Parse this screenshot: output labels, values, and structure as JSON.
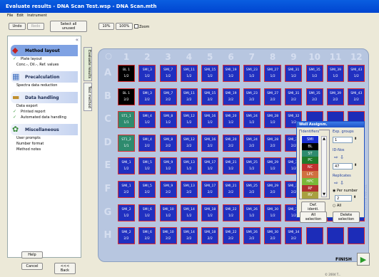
{
  "window": {
    "title": "Evaluate results - DNA Scan Test.wsp - DNA Scan.mth"
  },
  "menu": [
    "File",
    "Edit",
    "Instrument"
  ],
  "toolbar": {
    "undo": "Undo",
    "redo": "Redo",
    "select_all": "Select all unused",
    "zoom10": "10%",
    "zoom100": "100%",
    "zoom_label": "Zoom"
  },
  "sidebar": {
    "sections": [
      {
        "title": "Method layout",
        "items": [
          "Plate layout",
          "Conc.-, Dil.-, Ref. values"
        ]
      },
      {
        "title": "Precalculation",
        "items": [
          "Spectra data reduction"
        ]
      },
      {
        "title": "Data handling",
        "items": [
          "Data export",
          "Printed report",
          "Automated data handling"
        ]
      },
      {
        "title": "Miscellaneous",
        "items": [
          "User prompts",
          "Number format",
          "Method notes"
        ]
      }
    ]
  },
  "vtabs": {
    "results": "Evaluate results",
    "test": "Test method"
  },
  "plate": {
    "columns": [
      "1",
      "2",
      "3",
      "4",
      "5",
      "6",
      "7",
      "8",
      "9",
      "10",
      "11",
      "12"
    ],
    "rows": [
      "A",
      "B",
      "C",
      "D",
      "E",
      "F",
      "G",
      "H"
    ],
    "wells": [
      [
        [
          "BL 1",
          "1/2"
        ],
        [
          "SMI_3",
          "1/2"
        ],
        [
          "SMI_7",
          "1/2"
        ],
        [
          "SMI_11",
          "1/2"
        ],
        [
          "SMI_15",
          "1/2"
        ],
        [
          "SMI_19",
          "1/2"
        ],
        [
          "SMI_23",
          "1/2"
        ],
        [
          "SMI_27",
          "1/2"
        ],
        [
          "SMI_31",
          "1/2"
        ],
        [
          "SMI_35",
          "1/2"
        ],
        [
          "SMI_39",
          "1/2"
        ],
        [
          "SMI_43",
          "1/2"
        ]
      ],
      [
        [
          "BL 1",
          "2/2"
        ],
        [
          "SMI_3",
          "2/2"
        ],
        [
          "SMI_7",
          "2/2"
        ],
        [
          "SMI_11",
          "2/2"
        ],
        [
          "SMI_15",
          "2/2"
        ],
        [
          "SMI_19",
          "2/2"
        ],
        [
          "SMI_23",
          "2/2"
        ],
        [
          "SMI_27",
          "2/2"
        ],
        [
          "SMI_31",
          "2/2"
        ],
        [
          "SMI_35",
          "2/2"
        ],
        [
          "SMI_39",
          "2/2"
        ],
        [
          "SMI_43",
          "2/2"
        ]
      ],
      [
        [
          "ST1_1",
          "1/1"
        ],
        [
          "SMI_4",
          "1/2"
        ],
        [
          "SMI_8",
          "1/2"
        ],
        [
          "SMI_12",
          "1/2"
        ],
        [
          "SMI_16",
          "1/2"
        ],
        [
          "SMI_20",
          "1/2"
        ],
        [
          "SMI_24",
          "1/2"
        ],
        [
          "SMI_28",
          "1/2"
        ],
        [
          "SMI_32",
          "1/2"
        ],
        [
          "",
          ""
        ],
        [
          "",
          ""
        ],
        [
          "",
          ""
        ]
      ],
      [
        [
          "ST1_2",
          "1/1"
        ],
        [
          "SMI_4",
          "2/2"
        ],
        [
          "SMI_8",
          "2/2"
        ],
        [
          "SMI_12",
          "2/2"
        ],
        [
          "SMI_16",
          "2/2"
        ],
        [
          "SMI_20",
          "2/2"
        ],
        [
          "SMI_24",
          "2/2"
        ],
        [
          "SMI_28",
          "2/2"
        ],
        [
          "SMI_32",
          "2/2"
        ],
        [
          "",
          ""
        ],
        [
          "",
          ""
        ],
        [
          "",
          ""
        ]
      ],
      [
        [
          "SMI_1",
          "1/2"
        ],
        [
          "SMI_5",
          "1/2"
        ],
        [
          "SMI_9",
          "1/2"
        ],
        [
          "SMI_13",
          "1/2"
        ],
        [
          "SMI_17",
          "1/2"
        ],
        [
          "SMI_21",
          "1/2"
        ],
        [
          "SMI_25",
          "1/2"
        ],
        [
          "SMI_29",
          "1/2"
        ],
        [
          "SMI_33",
          "1/2"
        ],
        [
          "",
          ""
        ],
        [
          "",
          ""
        ],
        [
          "",
          ""
        ]
      ],
      [
        [
          "SMI_1",
          "2/2"
        ],
        [
          "SMI_5",
          "2/2"
        ],
        [
          "SMI_9",
          "2/2"
        ],
        [
          "SMI_13",
          "2/2"
        ],
        [
          "SMI_17",
          "2/2"
        ],
        [
          "SMI_21",
          "2/2"
        ],
        [
          "SMI_25",
          "2/2"
        ],
        [
          "SMI_29",
          "2/2"
        ],
        [
          "SMI_33",
          "2/2"
        ],
        [
          "",
          ""
        ],
        [
          "",
          ""
        ],
        [
          "",
          ""
        ]
      ],
      [
        [
          "SMI_2",
          "1/2"
        ],
        [
          "SMI_6",
          "1/2"
        ],
        [
          "SMI_10",
          "1/2"
        ],
        [
          "SMI_14",
          "1/2"
        ],
        [
          "SMI_18",
          "1/2"
        ],
        [
          "SMI_22",
          "1/2"
        ],
        [
          "SMI_26",
          "1/2"
        ],
        [
          "SMI_30",
          "1/2"
        ],
        [
          "SMI_34",
          "1/2"
        ],
        [
          "",
          ""
        ],
        [
          "",
          ""
        ],
        [
          "",
          ""
        ]
      ],
      [
        [
          "SMI_2",
          "2/2"
        ],
        [
          "SMI_6",
          "2/2"
        ],
        [
          "SMI_10",
          "2/2"
        ],
        [
          "SMI_14",
          "2/2"
        ],
        [
          "SMI_18",
          "2/2"
        ],
        [
          "SMI_22",
          "2/2"
        ],
        [
          "SMI_26",
          "2/2"
        ],
        [
          "SMI_30",
          "2/2"
        ],
        [
          "SMI_34",
          "2/2"
        ],
        [
          "",
          ""
        ],
        [
          "",
          ""
        ],
        [
          "",
          ""
        ]
      ]
    ]
  },
  "dialog": {
    "title": "Well Assignm.",
    "identifiers_label": "Identifiers",
    "identifiers": [
      {
        "label": "SMI",
        "color": "#1a2fd0"
      },
      {
        "label": "BL",
        "color": "#000000"
      },
      {
        "label": "ST",
        "color": "#2e8b6e"
      },
      {
        "label": "PC",
        "color": "#1f7a2a"
      },
      {
        "label": "NC",
        "color": "#c03030"
      },
      {
        "label": "LPC",
        "color": "#d07040"
      },
      {
        "label": "HPC",
        "color": "#7ab838"
      },
      {
        "label": "RF",
        "color": "#b03030"
      },
      {
        "label": "RV",
        "color": "#a8a040"
      }
    ],
    "exp_groups_label": "Exp. groups",
    "exp_groups_value": "1",
    "id_nos_label": "ID-Nos",
    "id_nos_value": "47",
    "replicates_label": "Replicates",
    "per_number": "Per number",
    "replicates_value": "2",
    "all": "All",
    "def_ident": "Def. identi.",
    "all_selection": "All selection",
    "delete_selection": "Delete selection"
  },
  "footer": {
    "help": "Help",
    "cancel": "Cancel",
    "back": "<<< Back",
    "finish": "FINISH",
    "copyright": "© 2004 T..."
  },
  "watermark": "TECAN Austria"
}
